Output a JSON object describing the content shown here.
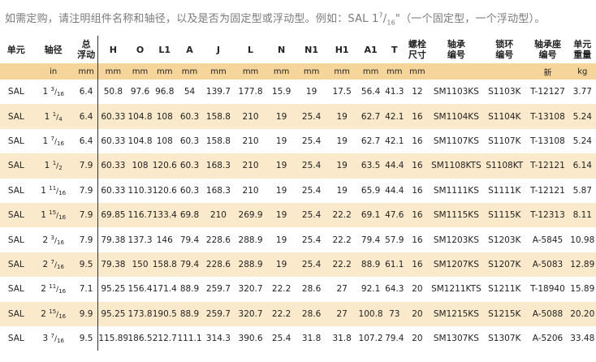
{
  "note": {
    "text_before": "如需定购，请注明组件名称和轴径，以及是否为固定型或浮动型。例如：SAL 1",
    "sup": "7",
    "slash": "/",
    "sub": "16",
    "text_after": "\"（一个固定型，一个浮动型）。"
  },
  "headers": [
    "单元",
    "轴径",
    "总\n浮动",
    "H",
    "O",
    "L1",
    "A",
    "J",
    "L",
    "N",
    "N1",
    "H1",
    "A1",
    "T",
    "螺栓\n尺寸",
    "轴承\n编号",
    "锁环\n编号",
    "轴承座\n编号",
    "单元\n重量"
  ],
  "units": [
    "",
    "in",
    "mm",
    "mm",
    "mm",
    "mm",
    "mm",
    "mm",
    "mm",
    "mm",
    "mm",
    "mm",
    "mm",
    "mm",
    "mm",
    "",
    "",
    "新",
    "kg"
  ],
  "rows": [
    {
      "unit": "SAL",
      "shaft": {
        "whole": "1",
        "num": "3",
        "den": "16"
      },
      "cells": [
        "6.4",
        "50.8",
        "97.6",
        "96.8",
        "54",
        "139.7",
        "177.8",
        "15.9",
        "19",
        "17.5",
        "56.4",
        "41.3",
        "12",
        "SM1103KS",
        "S1103K",
        "T-12127",
        "3.77"
      ]
    },
    {
      "unit": "SAL",
      "shaft": {
        "whole": "1",
        "num": "1",
        "den": "4"
      },
      "cells": [
        "6.4",
        "60.33",
        "104.8",
        "108",
        "60.3",
        "158.8",
        "210",
        "19",
        "25.4",
        "19",
        "62.7",
        "42.1",
        "16",
        "SM1104KS",
        "S1104K",
        "T-13108",
        "5.24"
      ]
    },
    {
      "unit": "SAL",
      "shaft": {
        "whole": "1",
        "num": "7",
        "den": "16"
      },
      "cells": [
        "6.4",
        "60.33",
        "104.8",
        "108",
        "60.3",
        "158.8",
        "210",
        "19",
        "25.4",
        "19",
        "62.7",
        "42.1",
        "16",
        "SM1107KS",
        "S1107K",
        "T-13108",
        "5.24"
      ]
    },
    {
      "unit": "SAL",
      "shaft": {
        "whole": "1",
        "num": "1",
        "den": "2"
      },
      "cells": [
        "7.9",
        "60.33",
        "108",
        "120.6",
        "60.3",
        "168.3",
        "210",
        "19",
        "25.4",
        "19",
        "63.5",
        "44.4",
        "16",
        "SM1108KTS",
        "S1108KT",
        "T-12121",
        "6.14"
      ]
    },
    {
      "unit": "SAL",
      "shaft": {
        "whole": "1",
        "num": "11",
        "den": "16"
      },
      "cells": [
        "7.9",
        "60.33",
        "110.3",
        "120.6",
        "60.3",
        "168.3",
        "210",
        "19",
        "25.4",
        "19",
        "65.9",
        "44.4",
        "16",
        "SM1111KS",
        "S1111K",
        "T-12121",
        "5.87"
      ]
    },
    {
      "unit": "SAL",
      "shaft": {
        "whole": "1",
        "num": "15",
        "den": "16"
      },
      "cells": [
        "7.9",
        "69.85",
        "116.7",
        "133.4",
        "69.8",
        "210",
        "269.9",
        "19",
        "25.4",
        "22.2",
        "69.1",
        "47.6",
        "16",
        "SM1115KS",
        "S1115K",
        "T-12313",
        "8.11"
      ]
    },
    {
      "unit": "SAL",
      "shaft": {
        "whole": "2",
        "num": "3",
        "den": "16"
      },
      "cells": [
        "7.9",
        "79.38",
        "137.3",
        "146",
        "79.4",
        "228.6",
        "288.9",
        "19",
        "25.4",
        "22.2",
        "79.4",
        "57.9",
        "16",
        "SM1203KS",
        "S1203K",
        "A-5845",
        "10.98"
      ]
    },
    {
      "unit": "SAL",
      "shaft": {
        "whole": "2",
        "num": "7",
        "den": "16"
      },
      "cells": [
        "9.5",
        "79.38",
        "150",
        "158.8",
        "79.4",
        "228.6",
        "288.9",
        "19",
        "25.4",
        "22.2",
        "88.9",
        "61.1",
        "16",
        "SM1207KS",
        "S1207K",
        "A-5083",
        "12.89"
      ]
    },
    {
      "unit": "SAL",
      "shaft": {
        "whole": "2",
        "num": "11",
        "den": "16"
      },
      "cells": [
        "7.1",
        "95.25",
        "156.4",
        "171.4",
        "88.9",
        "259.7",
        "320.7",
        "22.2",
        "28.6",
        "27",
        "92.1",
        "64.3",
        "20",
        "SM1211KTS",
        "S1211K",
        "T-18940",
        "15.89"
      ]
    },
    {
      "unit": "SAL",
      "shaft": {
        "whole": "2",
        "num": "15",
        "den": "16"
      },
      "cells": [
        "9.9",
        "95.25",
        "173.8",
        "190.5",
        "88.9",
        "259.7",
        "320.7",
        "22.2",
        "28.6",
        "27",
        "100.8",
        "73",
        "20",
        "SM1215KS",
        "S1215K",
        "A-5088",
        "20.20"
      ]
    },
    {
      "unit": "SAL",
      "shaft": {
        "whole": "3",
        "num": "7",
        "den": "16"
      },
      "cells": [
        "9.5",
        "115.89",
        "186.5",
        "212.7",
        "111.1",
        "314.3",
        "390.6",
        "25.4",
        "31.8",
        "31.8",
        "107.2",
        "79.4",
        "20",
        "SM1307KS",
        "S1307K",
        "A-5206",
        "33.48"
      ]
    }
  ]
}
